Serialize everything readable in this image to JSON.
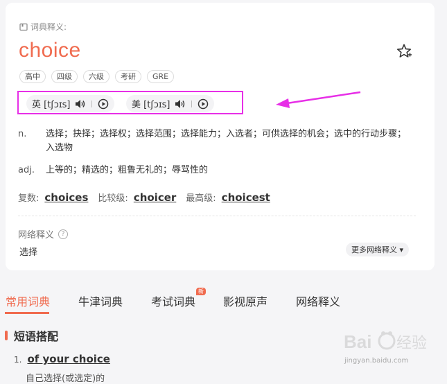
{
  "dict": {
    "header": "词典释义:",
    "word": "choice",
    "tags": [
      "高中",
      "四级",
      "六级",
      "考研",
      "GRE"
    ]
  },
  "pronunciations": [
    {
      "region": "英",
      "phonetic": "[tʃɔɪs]"
    },
    {
      "region": "美",
      "phonetic": "[tʃɔɪs]"
    }
  ],
  "definitions": [
    {
      "pos": "n.",
      "meaning": "选择；抉择；选择权；选择范围；选择能力；入选者；可供选择的机会；选中的行动步骤；入选物"
    },
    {
      "pos": "adj.",
      "meaning": "上等的；精选的；粗鲁无礼的；辱骂性的"
    }
  ],
  "forms": [
    {
      "label": "复数:",
      "value": "choices"
    },
    {
      "label": "比较级:",
      "value": "choicer"
    },
    {
      "label": "最高级:",
      "value": "choicest"
    }
  ],
  "network": {
    "title": "网络释义",
    "help": "?",
    "value": "选择",
    "more": "更多网络释义 ▾"
  },
  "tabs": [
    {
      "label": "常用词典"
    },
    {
      "label": "牛津词典"
    },
    {
      "label": "考试词典",
      "badge": "新"
    },
    {
      "label": "影视原声"
    },
    {
      "label": "网络释义"
    }
  ],
  "section": {
    "title": "短语搭配",
    "phrases": [
      {
        "num": "1.",
        "text": "of your choice",
        "desc": "自己选择(或选定)的"
      }
    ]
  },
  "watermark": {
    "text": "jingyan.baidu.com"
  },
  "colors": {
    "accent": "#f06b4f",
    "highlight": "#e72fe7"
  }
}
